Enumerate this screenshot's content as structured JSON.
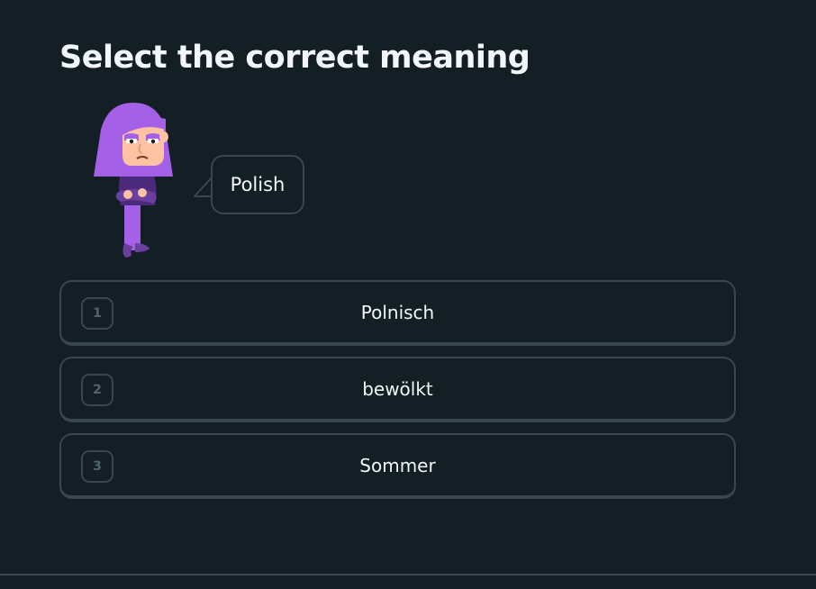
{
  "prompt": {
    "title": "Select the correct meaning"
  },
  "character": {
    "icon": "lily-character-icon",
    "speech": "Polish"
  },
  "choices": [
    {
      "key": "1",
      "label": "Polnisch"
    },
    {
      "key": "2",
      "label": "bewölkt"
    },
    {
      "key": "3",
      "label": "Sommer"
    }
  ],
  "colors": {
    "background": "#131f24",
    "border": "#37464f",
    "text": "#f1f7fb",
    "key_text": "#52656d",
    "hair": "#a560e8",
    "skin": "#ffc2a3"
  }
}
